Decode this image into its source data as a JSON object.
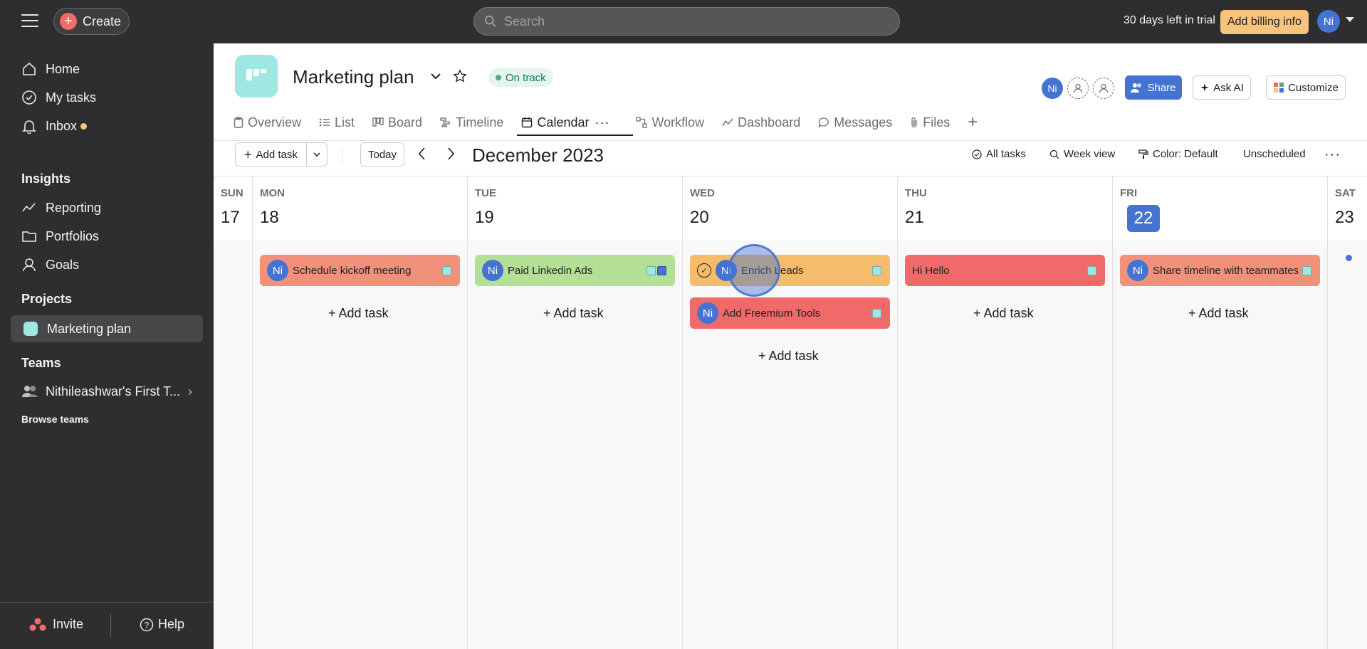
{
  "topbar": {
    "create_label": "Create",
    "search_placeholder": "Search",
    "trial_text": "30 days left in trial",
    "billing_label": "Add billing info",
    "user_initials": "Ni"
  },
  "sidebar": {
    "nav": [
      {
        "label": "Home",
        "icon": "home-icon"
      },
      {
        "label": "My tasks",
        "icon": "check-circle-icon"
      },
      {
        "label": "Inbox",
        "icon": "bell-icon"
      }
    ],
    "insights_title": "Insights",
    "insights": [
      {
        "label": "Reporting",
        "icon": "line-chart-icon"
      },
      {
        "label": "Portfolios",
        "icon": "folder-icon"
      },
      {
        "label": "Goals",
        "icon": "user-goal-icon"
      }
    ],
    "projects_title": "Projects",
    "project": "Marketing plan",
    "teams_title": "Teams",
    "team": "Nithileashwar's First T...",
    "browse_teams": "Browse teams",
    "invite_label": "Invite",
    "help_label": "Help"
  },
  "project": {
    "title": "Marketing plan",
    "status": "On track",
    "member_initials": "Ni",
    "share_label": "Share",
    "ask_ai_label": "Ask AI",
    "customize_label": "Customize",
    "colors": {
      "accent": "#4573d2",
      "project": "#9ee7e3"
    }
  },
  "tabs": [
    {
      "label": "Overview",
      "icon": "clipboard-icon"
    },
    {
      "label": "List",
      "icon": "list-icon"
    },
    {
      "label": "Board",
      "icon": "board-icon"
    },
    {
      "label": "Timeline",
      "icon": "timeline-icon"
    },
    {
      "label": "Calendar",
      "icon": "calendar-icon",
      "active": true
    },
    {
      "label": "Workflow",
      "icon": "workflow-icon"
    },
    {
      "label": "Dashboard",
      "icon": "dashboard-icon"
    },
    {
      "label": "Messages",
      "icon": "chat-icon"
    },
    {
      "label": "Files",
      "icon": "paperclip-icon"
    }
  ],
  "toolbar": {
    "add_task": "Add task",
    "today": "Today",
    "month": "December 2023",
    "all_tasks": "All tasks",
    "week_view": "Week view",
    "color": "Color: Default",
    "unscheduled": "Unscheduled"
  },
  "calendar": {
    "add_task_label": "Add task",
    "days": [
      {
        "day": "SUN",
        "date": "17"
      },
      {
        "day": "MON",
        "date": "18"
      },
      {
        "day": "TUE",
        "date": "19"
      },
      {
        "day": "WED",
        "date": "20"
      },
      {
        "day": "THU",
        "date": "21"
      },
      {
        "day": "FRI",
        "date": "22",
        "today": true
      },
      {
        "day": "SAT",
        "date": "23"
      }
    ],
    "tasks": {
      "mon": [
        {
          "title": "Schedule kickoff meeting",
          "assignee": "Ni",
          "color": "#f1917a"
        }
      ],
      "tue": [
        {
          "title": "Paid Linkedin Ads",
          "assignee": "Ni",
          "color": "#b3df97"
        }
      ],
      "wed": [
        {
          "title": "Enrich Leads",
          "assignee": "Ni",
          "color": "#f5bc6b"
        },
        {
          "title": "Add Freemium Tools",
          "assignee": "Ni",
          "color": "#f06a6a"
        }
      ],
      "thu": [
        {
          "title": "Hi Hello",
          "color": "#f06a6a"
        }
      ],
      "fri": [
        {
          "title": "Share timeline with teammates",
          "assignee": "Ni",
          "color": "#f1917a"
        }
      ]
    }
  }
}
